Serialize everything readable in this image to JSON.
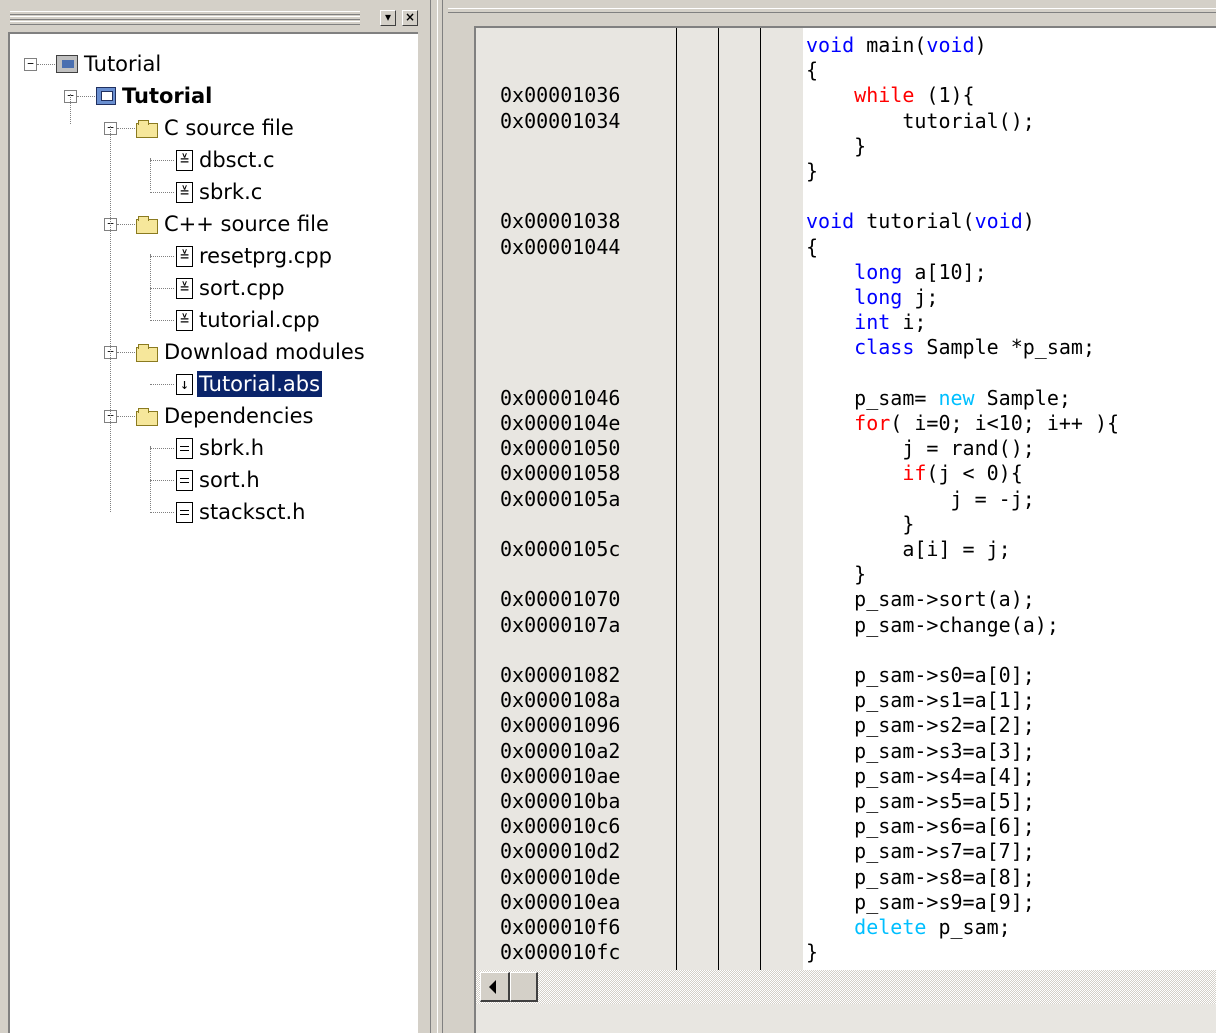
{
  "workspace": {
    "tree": [
      {
        "label": "Tutorial",
        "icon": "workspace-icon",
        "expanded": true
      },
      {
        "label": "Tutorial",
        "icon": "project-icon",
        "bold": true,
        "expanded": true
      },
      {
        "label": "C source file",
        "icon": "folder-icon",
        "expanded": true
      },
      {
        "label": "dbsct.c",
        "icon": "source-file-icon"
      },
      {
        "label": "sbrk.c",
        "icon": "source-file-icon"
      },
      {
        "label": "C++ source file",
        "icon": "folder-icon",
        "expanded": true
      },
      {
        "label": "resetprg.cpp",
        "icon": "source-file-icon"
      },
      {
        "label": "sort.cpp",
        "icon": "source-file-icon"
      },
      {
        "label": "tutorial.cpp",
        "icon": "source-file-icon"
      },
      {
        "label": "Download modules",
        "icon": "folder-icon",
        "expanded": true
      },
      {
        "label": "Tutorial.abs",
        "icon": "download-module-icon",
        "selected": true
      },
      {
        "label": "Dependencies",
        "icon": "folder-icon",
        "expanded": true
      },
      {
        "label": "sbrk.h",
        "icon": "header-file-icon"
      },
      {
        "label": "sort.h",
        "icon": "header-file-icon"
      },
      {
        "label": "stacksct.h",
        "icon": "header-file-icon"
      }
    ]
  },
  "editor": {
    "rows": [
      {
        "addr": "",
        "code": [
          [
            "kw-blue",
            "void"
          ],
          [
            "",
            " main("
          ],
          [
            "kw-blue",
            "void"
          ],
          [
            "",
            ")"
          ]
        ]
      },
      {
        "addr": "",
        "code": [
          [
            "",
            "{"
          ]
        ]
      },
      {
        "addr": "0x00001036",
        "code": [
          [
            "",
            "    "
          ],
          [
            "kw-red",
            "while"
          ],
          [
            "",
            " (1){"
          ]
        ]
      },
      {
        "addr": "0x00001034",
        "code": [
          [
            "",
            "        tutorial();"
          ]
        ]
      },
      {
        "addr": "",
        "code": [
          [
            "",
            "    }"
          ]
        ]
      },
      {
        "addr": "",
        "code": [
          [
            "",
            "}"
          ]
        ]
      },
      {
        "addr": "",
        "code": [
          [
            "",
            ""
          ]
        ]
      },
      {
        "addr": "0x00001038",
        "code": [
          [
            "kw-blue",
            "void"
          ],
          [
            "",
            " tutorial("
          ],
          [
            "kw-blue",
            "void"
          ],
          [
            "",
            ")"
          ]
        ]
      },
      {
        "addr": "0x00001044",
        "code": [
          [
            "",
            "{"
          ]
        ]
      },
      {
        "addr": "",
        "code": [
          [
            "",
            "    "
          ],
          [
            "kw-blue",
            "long"
          ],
          [
            "",
            " a[10];"
          ]
        ]
      },
      {
        "addr": "",
        "code": [
          [
            "",
            "    "
          ],
          [
            "kw-blue",
            "long"
          ],
          [
            "",
            " j;"
          ]
        ]
      },
      {
        "addr": "",
        "code": [
          [
            "",
            "    "
          ],
          [
            "kw-blue",
            "int"
          ],
          [
            "",
            " i;"
          ]
        ]
      },
      {
        "addr": "",
        "code": [
          [
            "",
            "    "
          ],
          [
            "kw-blue",
            "class"
          ],
          [
            "",
            " Sample *p_sam;"
          ]
        ]
      },
      {
        "addr": "",
        "code": [
          [
            "",
            ""
          ]
        ]
      },
      {
        "addr": "0x00001046",
        "code": [
          [
            "",
            "    p_sam= "
          ],
          [
            "kw-cyan",
            "new"
          ],
          [
            "",
            " Sample;"
          ]
        ]
      },
      {
        "addr": "0x0000104e",
        "code": [
          [
            "",
            "    "
          ],
          [
            "kw-red",
            "for"
          ],
          [
            "",
            "( i=0; i<10; i++ ){"
          ]
        ]
      },
      {
        "addr": "0x00001050",
        "code": [
          [
            "",
            "        j = rand();"
          ]
        ]
      },
      {
        "addr": "0x00001058",
        "code": [
          [
            "",
            "        "
          ],
          [
            "kw-red",
            "if"
          ],
          [
            "",
            "(j < 0){"
          ]
        ]
      },
      {
        "addr": "0x0000105a",
        "code": [
          [
            "",
            "            j = -j;"
          ]
        ]
      },
      {
        "addr": "",
        "code": [
          [
            "",
            "        }"
          ]
        ]
      },
      {
        "addr": "0x0000105c",
        "code": [
          [
            "",
            "        a[i] = j;"
          ]
        ]
      },
      {
        "addr": "",
        "code": [
          [
            "",
            "    }"
          ]
        ]
      },
      {
        "addr": "0x00001070",
        "code": [
          [
            "",
            "    p_sam->sort(a);"
          ]
        ]
      },
      {
        "addr": "0x0000107a",
        "code": [
          [
            "",
            "    p_sam->change(a);"
          ]
        ]
      },
      {
        "addr": "",
        "code": [
          [
            "",
            ""
          ]
        ]
      },
      {
        "addr": "0x00001082",
        "code": [
          [
            "",
            "    p_sam->s0=a[0];"
          ]
        ]
      },
      {
        "addr": "0x0000108a",
        "code": [
          [
            "",
            "    p_sam->s1=a[1];"
          ]
        ]
      },
      {
        "addr": "0x00001096",
        "code": [
          [
            "",
            "    p_sam->s2=a[2];"
          ]
        ]
      },
      {
        "addr": "0x000010a2",
        "code": [
          [
            "",
            "    p_sam->s3=a[3];"
          ]
        ]
      },
      {
        "addr": "0x000010ae",
        "code": [
          [
            "",
            "    p_sam->s4=a[4];"
          ]
        ]
      },
      {
        "addr": "0x000010ba",
        "code": [
          [
            "",
            "    p_sam->s5=a[5];"
          ]
        ]
      },
      {
        "addr": "0x000010c6",
        "code": [
          [
            "",
            "    p_sam->s6=a[6];"
          ]
        ]
      },
      {
        "addr": "0x000010d2",
        "code": [
          [
            "",
            "    p_sam->s7=a[7];"
          ]
        ]
      },
      {
        "addr": "0x000010de",
        "code": [
          [
            "",
            "    p_sam->s8=a[8];"
          ]
        ]
      },
      {
        "addr": "0x000010ea",
        "code": [
          [
            "",
            "    p_sam->s9=a[9];"
          ]
        ]
      },
      {
        "addr": "0x000010f6",
        "code": [
          [
            "",
            "    "
          ],
          [
            "kw-cyan",
            "delete"
          ],
          [
            "",
            " p_sam;"
          ]
        ]
      },
      {
        "addr": "0x000010fc",
        "code": [
          [
            "",
            "}"
          ]
        ]
      }
    ]
  },
  "colors": {
    "keyword": "#0000ff",
    "control_keyword": "#ff0000",
    "operator_keyword": "#00bfff",
    "selection": "#0a246a"
  }
}
